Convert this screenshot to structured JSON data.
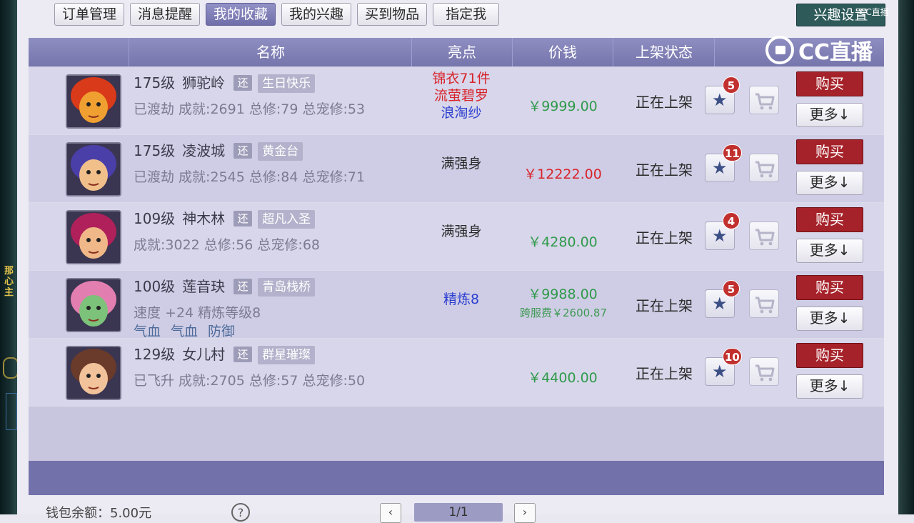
{
  "tabs": [
    {
      "label": "订单管理",
      "active": false
    },
    {
      "label": "消息提醒",
      "active": false
    },
    {
      "label": "我的收藏",
      "active": true
    },
    {
      "label": "我的兴趣",
      "active": false
    },
    {
      "label": "买到物品",
      "active": false
    },
    {
      "label": "指定我",
      "active": false
    }
  ],
  "interest_settings": "兴趣设置",
  "watermark": {
    "brand": "CC直播",
    "small": "CC直播"
  },
  "columns": {
    "name": "名称",
    "highlight": "亮点",
    "price": "价钱",
    "status": "上架状态"
  },
  "rows": [
    {
      "level": "175级",
      "school": "狮驼岭",
      "huan": "还",
      "server": "生日快乐",
      "info": "已渡劫 成就:2691 总修:79 总宠修:53",
      "extra": "",
      "highlights": [
        {
          "text": "锦衣71件",
          "color": "#d8232a"
        },
        {
          "text": "流萤碧罗",
          "color": "#d8232a"
        },
        {
          "text": "浪淘纱",
          "color": "#2b3fd0"
        }
      ],
      "price": "￥9999.00",
      "price_color": "#2f9a4a",
      "price_sub": "",
      "status": "正在上架",
      "fav_count": "5",
      "buy": "购买",
      "more": "更多↓",
      "avatar": "lion-demon-avatar",
      "avatar_colors": [
        "#d83a1a",
        "#f0a030"
      ]
    },
    {
      "level": "175级",
      "school": "凌波城",
      "huan": "还",
      "server": "黄金台",
      "info": "已渡劫 成就:2545 总修:84 总宠修:71",
      "extra": "",
      "highlights": [
        {
          "text": "满强身",
          "color": "#2b2b2b"
        }
      ],
      "price": "￥12222.00",
      "price_color": "#d8232a",
      "price_sub": "",
      "status": "正在上架",
      "fav_count": "11",
      "buy": "购买",
      "more": "更多↓",
      "avatar": "blue-hair-warrior-avatar",
      "avatar_colors": [
        "#4a3fa8",
        "#f1c08a"
      ]
    },
    {
      "level": "109级",
      "school": "神木林",
      "huan": "还",
      "server": "超凡入圣",
      "info": "成就:3022 总修:56 总宠修:68",
      "extra": "",
      "highlights": [
        {
          "text": "满强身",
          "color": "#2b2b2b"
        }
      ],
      "price": "￥4280.00",
      "price_color": "#2f9a4a",
      "price_sub": "",
      "status": "正在上架",
      "fav_count": "4",
      "buy": "购买",
      "more": "更多↓",
      "avatar": "red-hair-girl-avatar",
      "avatar_colors": [
        "#b0205a",
        "#f0b888"
      ]
    },
    {
      "level": "100级",
      "school": "莲音玦",
      "huan": "还",
      "server": "青岛栈桥",
      "info": "速度 +24 精炼等级8",
      "extra": [
        "气血",
        "气血",
        "防御"
      ],
      "highlights": [
        {
          "text": "精炼8",
          "color": "#2b3fd0"
        }
      ],
      "price": "￥9988.00",
      "price_color": "#2f9a4a",
      "price_sub": "跨服费￥2600.87",
      "status": "正在上架",
      "fav_count": "5",
      "buy": "购买",
      "more": "更多↓",
      "avatar": "lotus-jade-avatar",
      "avatar_colors": [
        "#e27fb0",
        "#7cc27a"
      ]
    },
    {
      "level": "129级",
      "school": "女儿村",
      "huan": "还",
      "server": "群星璀璨",
      "info": "已飞升 成就:2705 总修:57 总宠修:50",
      "extra": "",
      "highlights": [],
      "price": "￥4400.00",
      "price_color": "#2f9a4a",
      "price_sub": "",
      "status": "正在上架",
      "fav_count": "10",
      "buy": "购买",
      "more": "更多↓",
      "avatar": "headband-girl-avatar",
      "avatar_colors": [
        "#6a3a2a",
        "#f2c39a"
      ]
    }
  ],
  "footer": {
    "wallet": "钱包余额：5.00元",
    "help": "?",
    "prev": "‹",
    "next": "›",
    "page": "1/1"
  },
  "side_glyph": "那\n心\n主"
}
